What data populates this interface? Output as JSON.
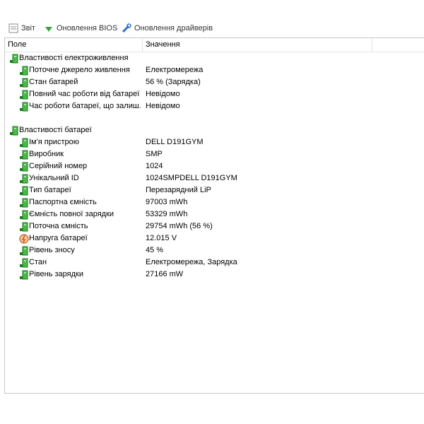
{
  "toolbar": {
    "items": [
      {
        "label": "Звіт",
        "icon": "report-icon"
      },
      {
        "label": "Оновлення BIOS",
        "icon": "bios-update-icon"
      },
      {
        "label": "Оновлення драйверів",
        "icon": "driver-update-icon"
      }
    ]
  },
  "columns": {
    "field": "Поле",
    "value": "Значення"
  },
  "groups": [
    {
      "title": "Властивості електроживлення",
      "icon": "power-properties-icon",
      "rows": [
        {
          "field": "Поточне джерело живлення",
          "value": "Електромережа",
          "icon": "battery-icon"
        },
        {
          "field": "Стан батарей",
          "value": "56 % (Зарядка)",
          "icon": "battery-icon"
        },
        {
          "field": "Повний час роботи від батареї",
          "value": "Невідомо",
          "icon": "battery-icon"
        },
        {
          "field": "Час роботи батареї, що залиш...",
          "value": "Невідомо",
          "icon": "battery-icon"
        }
      ]
    },
    {
      "title": "Властивості батареї",
      "icon": "battery-properties-icon",
      "rows": [
        {
          "field": "Ім'я пристрою",
          "value": "DELL D191GYM",
          "icon": "battery-icon"
        },
        {
          "field": "Виробник",
          "value": "SMP",
          "icon": "battery-icon"
        },
        {
          "field": "Серійний номер",
          "value": "1024",
          "icon": "battery-icon"
        },
        {
          "field": "Унікальний ID",
          "value": "1024SMPDELL D191GYM",
          "icon": "battery-icon"
        },
        {
          "field": "Тип батареї",
          "value": "Перезарядний LiP",
          "icon": "battery-icon"
        },
        {
          "field": "Паспортна ємність",
          "value": "97003 mWh",
          "icon": "battery-icon"
        },
        {
          "field": "Ємність повної зарядки",
          "value": "53329 mWh",
          "icon": "battery-icon"
        },
        {
          "field": "Поточна ємність",
          "value": "29754 mWh  (56 %)",
          "icon": "battery-icon"
        },
        {
          "field": "Напруга батареї",
          "value": "12.015 V",
          "icon": "voltage-icon"
        },
        {
          "field": "Рівень зносу",
          "value": "45 %",
          "icon": "battery-icon"
        },
        {
          "field": "Стан",
          "value": "Електромережа, Зарядка",
          "icon": "battery-icon"
        },
        {
          "field": "Рівень зарядки",
          "value": "27166 mW",
          "icon": "battery-icon"
        }
      ]
    }
  ]
}
